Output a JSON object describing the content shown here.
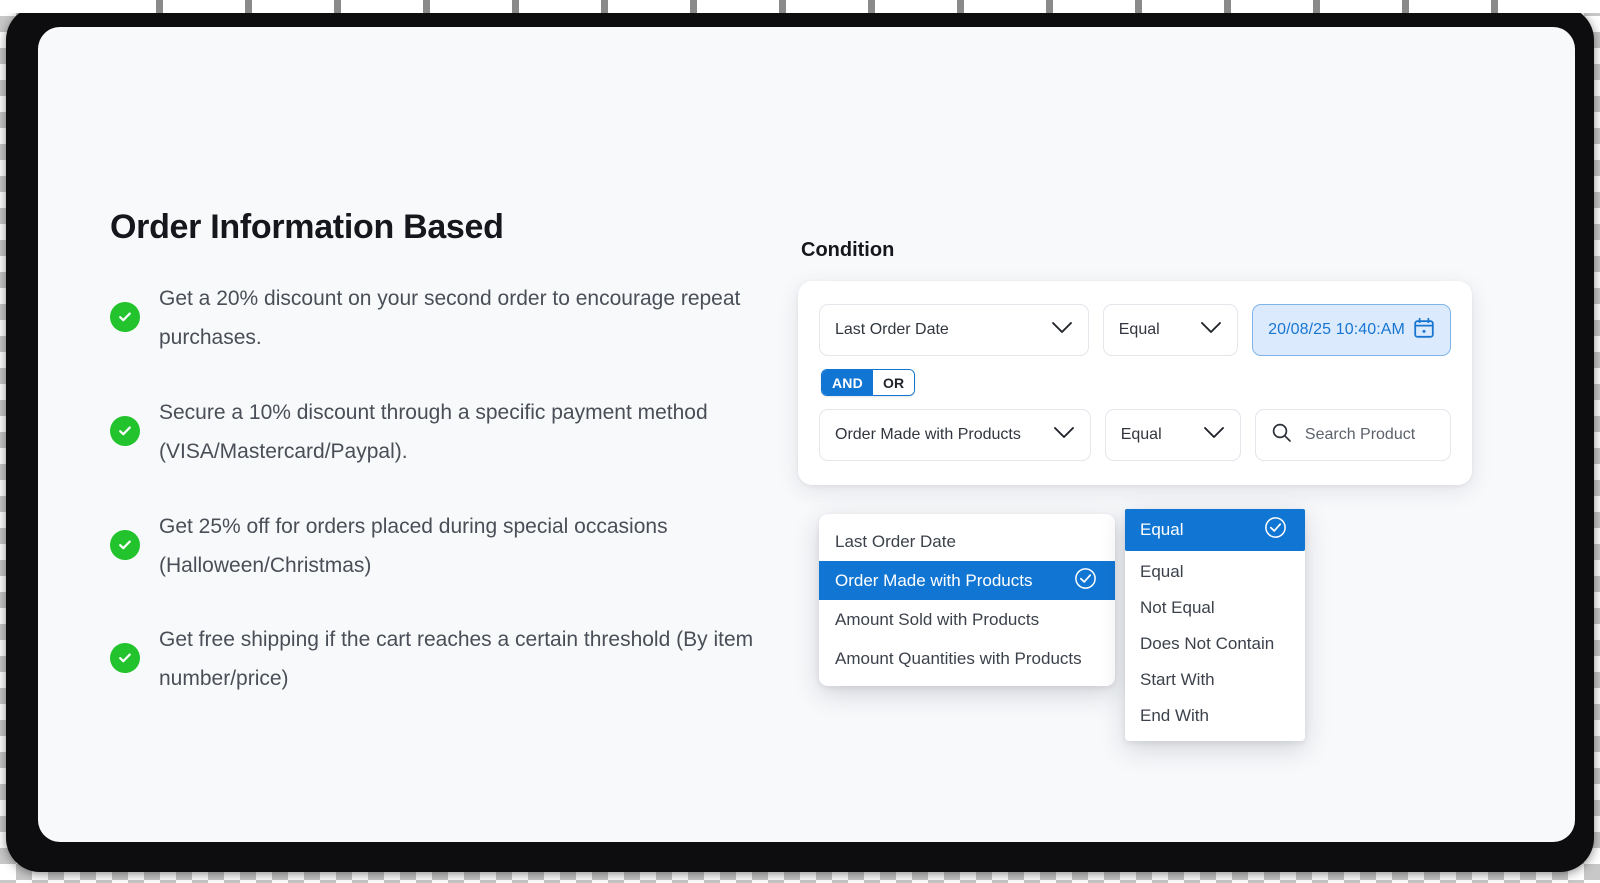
{
  "left": {
    "title": "Order Information Based",
    "bullets": [
      "Get a 20% discount on your second order to encourage repeat purchases.",
      "Secure a 10% discount through a specific payment method (VISA/Mastercard/Paypal).",
      "Get 25% off for orders placed during special occasions (Halloween/Christmas)",
      "Get free shipping if the cart reaches a certain threshold (By item number/price)"
    ]
  },
  "condition": {
    "label": "Condition",
    "rows": [
      {
        "attribute": "Last Order Date",
        "operator": "Equal",
        "value": "20/08/25 10:40:AM",
        "value_type": "date"
      },
      {
        "attribute": "Order Made with Products",
        "operator": "Equal",
        "value": "",
        "value_placeholder": "Search Product",
        "value_type": "search"
      }
    ],
    "logic_toggle": {
      "options": [
        "AND",
        "OR"
      ],
      "selected": "AND"
    }
  },
  "attribute_menu": {
    "selected": "Order Made with Products",
    "options": [
      "Last Order Date",
      "Order Made with Products",
      "Amount Sold with Products",
      "Amount Quantities with Products"
    ]
  },
  "operator_menu": {
    "selected": "Equal",
    "options": [
      "Equal",
      "Not Equal",
      "Does Not Contain",
      "Start With",
      "End With"
    ]
  },
  "colors": {
    "accent_blue": "#1176d3",
    "check_green": "#22c32d",
    "date_field_bg": "#dbeafd",
    "date_field_text": "#1876d2",
    "canvas_bg": "#f8f9fb",
    "frame": "#0d0d0f"
  }
}
